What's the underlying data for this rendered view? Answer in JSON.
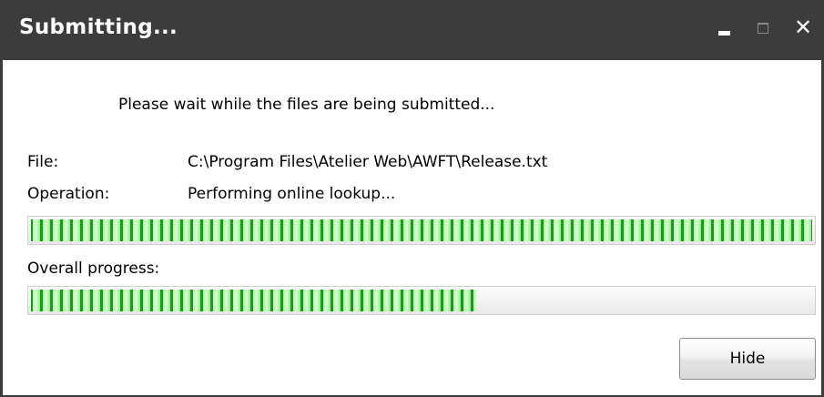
{
  "window": {
    "title": "Submitting...",
    "controls": {
      "minimize_icon": "minimize-icon",
      "maximize_icon": "maximize-icon",
      "close_icon": "close-icon",
      "close_glyph": "✕"
    },
    "titlebar_color": "#3c3c3c"
  },
  "dialog": {
    "message": "Please wait while the files are being submitted...",
    "file_label": "File:",
    "file_value": "C:\\Program Files\\Atelier Web\\AWFT\\Release.txt",
    "operation_label": "Operation:",
    "operation_value": "Performing online lookup...",
    "file_progress_fraction": 1.0,
    "overall_label": "Overall progress:",
    "overall_progress_fraction": 0.57,
    "progress_color": "#1aa81a",
    "hide_button_label": "Hide"
  }
}
